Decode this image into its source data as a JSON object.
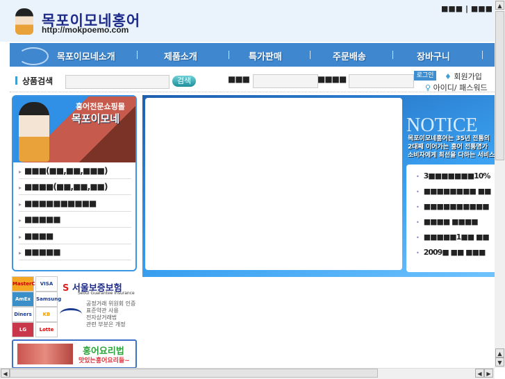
{
  "header": {
    "logo_title": "목포이모네홍어",
    "logo_url": "http://mokpoemo.com",
    "top_links": [
      "■■■",
      "■■■"
    ]
  },
  "nav": {
    "items": [
      "목포이모네소개",
      "제품소개",
      "특가판매",
      "주문배송",
      "장바구니"
    ]
  },
  "search": {
    "label": "상품검색",
    "button": "검색",
    "id_label": "■■■",
    "pw_label": "■■■■",
    "login": "로그인",
    "join": "회원가입",
    "find": "아이디/ 패스워드 찾기"
  },
  "left": {
    "promo_sub": "홍어전문쇼핑몰",
    "promo_title": "목포이모네",
    "categories": [
      "■■■(■■,■■,■■■)",
      "■■■■(■■,■■,■■)",
      "■■■■■■■■■■",
      "■■■■■",
      "■■■■",
      "■■■■■"
    ]
  },
  "payments": [
    "MasterCard",
    "VISA",
    "AmEx",
    "Samsung",
    "Diners",
    "KB",
    "LG",
    "Lotte"
  ],
  "insurance": {
    "name": "서울보증보험",
    "name_en": "Seoul Guarantee Insurance",
    "cert": [
      "공정거래 위원회 인증",
      "표준약관 사용",
      "전자상거래법",
      "관련 부분은 개정"
    ]
  },
  "cook": {
    "title": "홍어요리법",
    "subtitle": "맛있는홍어요리들~"
  },
  "notice": {
    "title": "NOTICE",
    "text": [
      "목포이모네홍어는 35년 전통의",
      "2대째 이어가는 홍어 전통명가",
      "소비자에게 최선을 다하는 서비스"
    ],
    "items": [
      "3■■■■■■■10%",
      "■■■■■■■■ ■■",
      "■■■■■■■■■■",
      "■■■■ ■■■■",
      "■■■■■1■■ ■■",
      "2009■ ■■ ■■■"
    ]
  }
}
